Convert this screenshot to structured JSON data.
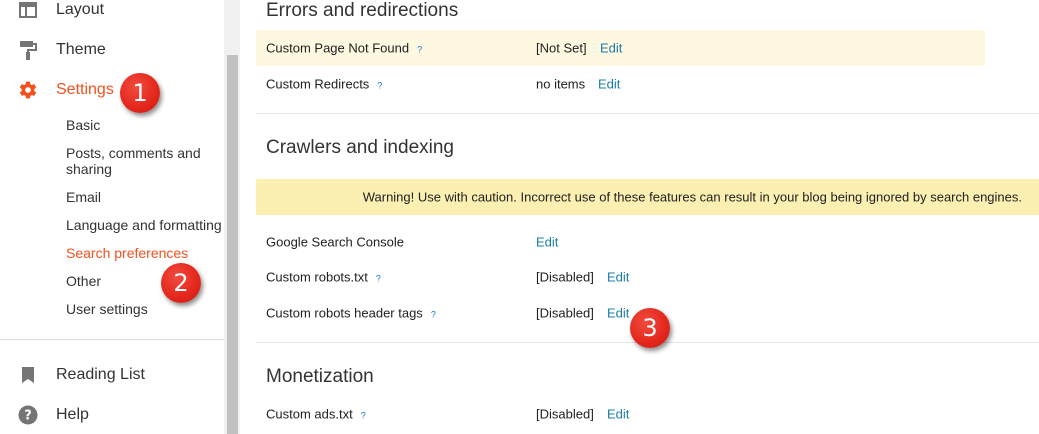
{
  "sidebar": {
    "items": [
      {
        "label": "Layout",
        "icon": "layout-icon"
      },
      {
        "label": "Theme",
        "icon": "paint-roller-icon"
      },
      {
        "label": "Settings",
        "icon": "gear-icon",
        "active": true
      }
    ],
    "sub_items": [
      {
        "label": "Basic"
      },
      {
        "label": "Posts, comments and sharing"
      },
      {
        "label": "Email"
      },
      {
        "label": "Language and formatting"
      },
      {
        "label": "Search preferences",
        "active": true
      },
      {
        "label": "Other"
      },
      {
        "label": "User settings"
      }
    ],
    "bottom_items": [
      {
        "label": "Reading List",
        "icon": "bookmark-icon"
      },
      {
        "label": "Help",
        "icon": "help-circle-icon"
      }
    ]
  },
  "sections": {
    "errors": {
      "title": "Errors and redirections",
      "rows": [
        {
          "label": "Custom Page Not Found",
          "value": "[Not Set]",
          "edit": "Edit"
        },
        {
          "label": "Custom Redirects",
          "value": "no items",
          "edit": "Edit"
        }
      ]
    },
    "crawlers": {
      "title": "Crawlers and indexing",
      "warning": "Warning! Use with caution. Incorrect use of these features can result in your blog being ignored by search engines.",
      "rows": [
        {
          "label": "Google Search Console",
          "value": "",
          "edit": "Edit"
        },
        {
          "label": "Custom robots.txt",
          "value": "[Disabled]",
          "edit": "Edit"
        },
        {
          "label": "Custom robots header tags",
          "value": "[Disabled]",
          "edit": "Edit"
        }
      ]
    },
    "monetization": {
      "title": "Monetization",
      "rows": [
        {
          "label": "Custom ads.txt",
          "value": "[Disabled]",
          "edit": "Edit"
        }
      ]
    }
  },
  "help_marker": "?",
  "callouts": [
    "1",
    "2",
    "3"
  ],
  "colors": {
    "accent": "#f4511e",
    "link": "#1a7ca8",
    "highlight_row": "#fff8e1",
    "warning_bg": "#fbefb2",
    "callout": "#e3261b"
  }
}
